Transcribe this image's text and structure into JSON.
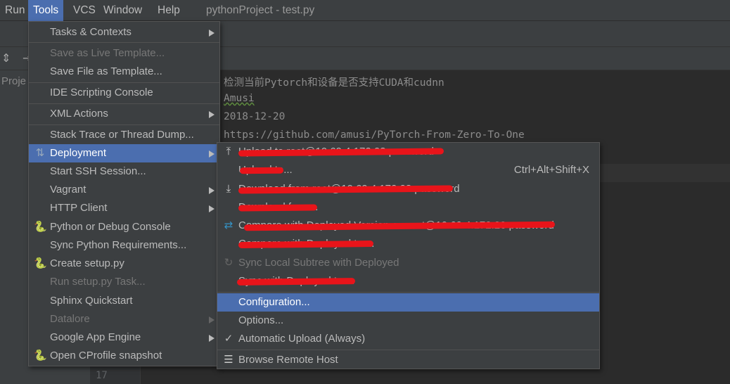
{
  "menubar": {
    "items": [
      "Run",
      "Tools",
      "VCS",
      "Window",
      "Help"
    ],
    "title": "pythonProject - test.py"
  },
  "project_panel_label": "Proje",
  "editor": {
    "lines": [
      "检测当前Pytorch和设备是否支持CUDA和cudnn",
      "Amusi",
      "2018-12-20",
      "https://github.com/amusi/PyTorch-From-Zero-To-One"
    ],
    "gutter_line": "17"
  },
  "tools_menu": [
    {
      "label": "Tasks & Contexts",
      "submenu": true
    },
    {
      "label": "Save as Live Template...",
      "disabled": true
    },
    {
      "label": "Save File as Template..."
    },
    {
      "label": "IDE Scripting Console"
    },
    {
      "label": "XML Actions",
      "submenu": true
    },
    {
      "label": "Stack Trace or Thread Dump..."
    },
    {
      "label": "Deployment",
      "submenu": true,
      "highlighted": true,
      "icon": "upload-download-icon"
    },
    {
      "label": "Start SSH Session..."
    },
    {
      "label": "Vagrant",
      "submenu": true
    },
    {
      "label": "HTTP Client",
      "submenu": true
    },
    {
      "label": "Python or Debug Console",
      "icon": "python-console-icon"
    },
    {
      "label": "Sync Python Requirements..."
    },
    {
      "label": "Create setup.py",
      "icon": "python-file-icon"
    },
    {
      "label": "Run setup.py Task...",
      "disabled": true
    },
    {
      "label": "Sphinx Quickstart"
    },
    {
      "label": "Datalore",
      "submenu": true,
      "disabled": true
    },
    {
      "label": "Google App Engine",
      "submenu": true
    },
    {
      "label": "Open CProfile snapshot",
      "icon": "cprofile-icon"
    }
  ],
  "deployment_menu": [
    {
      "label": "Upload to root@10.69.4.172:23 password",
      "icon": "upload-icon",
      "redacted": true
    },
    {
      "label": "Upload to...",
      "shortcut": "Ctrl+Alt+Shift+X",
      "redacted": true
    },
    {
      "label": "Download from root@10.69.4.172:23 password",
      "icon": "download-icon",
      "redacted": true
    },
    {
      "label": "Download from...",
      "redacted": true
    },
    {
      "label": "Compare with Deployed Version on root@10.69.4.172:23 password",
      "icon": "compare-icon",
      "redacted": true
    },
    {
      "label": "Compare with Deployed to ...",
      "redacted": true
    },
    {
      "label": "Sync Local Subtree with Deployed",
      "icon": "sync-icon",
      "disabled": true
    },
    {
      "label": "Sync with Deployed to ...",
      "redacted": true
    },
    {
      "label": "Configuration...",
      "highlighted": true
    },
    {
      "label": "Options..."
    },
    {
      "label": "Automatic Upload (Always)",
      "checked": true
    },
    {
      "label": "Browse Remote Host",
      "icon": "remote-host-icon"
    }
  ],
  "colors": {
    "highlight": "#4b6eaf",
    "menu_bg": "#3c3f41",
    "redaction": "#e8141a"
  }
}
